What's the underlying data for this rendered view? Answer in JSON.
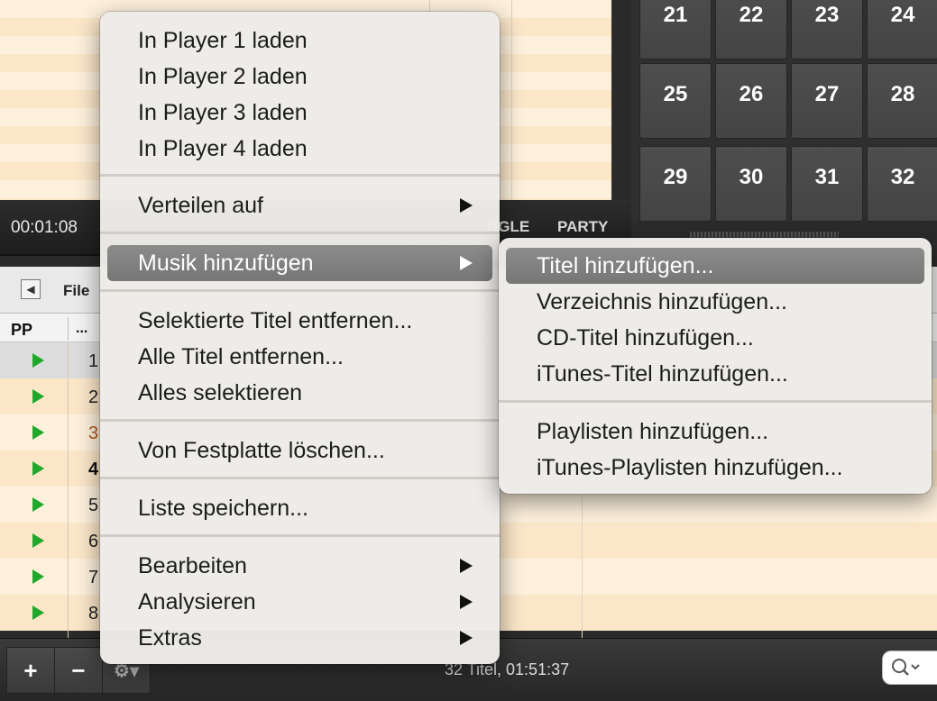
{
  "player": {
    "time": "00:01:08",
    "mode_single": "NGLE",
    "mode_party": "PARTY"
  },
  "pads": [
    "21",
    "22",
    "23",
    "24",
    "25",
    "26",
    "27",
    "28",
    "29",
    "30",
    "31",
    "32"
  ],
  "list": {
    "title": "File",
    "columns": {
      "pp": "PP",
      "num": "..."
    },
    "rows": [
      {
        "num": "1",
        "style": "selected"
      },
      {
        "num": "2",
        "style": "normal"
      },
      {
        "num": "3",
        "style": "orange"
      },
      {
        "num": "4",
        "style": "bold"
      },
      {
        "num": "5",
        "style": "normal"
      },
      {
        "num": "6",
        "style": "normal"
      },
      {
        "num": "7",
        "style": "normal"
      },
      {
        "num": "8",
        "style": "normal"
      }
    ],
    "status": "32 Titel,  01:51:37"
  },
  "bottom_bar": {
    "add_label": "+",
    "remove_label": "−",
    "gear_icon": "gear-icon",
    "search_icon": "search-icon"
  },
  "context_menu": {
    "items": [
      {
        "label": "In Player 1 laden"
      },
      {
        "label": "In Player 2 laden"
      },
      {
        "label": "In Player 3 laden"
      },
      {
        "label": "In Player 4 laden"
      },
      {
        "label": "Verteilen auf",
        "submenu": true
      },
      {
        "label": "Musik hinzufügen",
        "submenu": true,
        "highlighted": true
      },
      {
        "label": "Selektierte Titel entfernen..."
      },
      {
        "label": "Alle Titel entfernen..."
      },
      {
        "label": "Alles selektieren"
      },
      {
        "label": "Von Festplatte löschen..."
      },
      {
        "label": "Liste speichern..."
      },
      {
        "label": "Bearbeiten",
        "submenu": true
      },
      {
        "label": "Analysieren",
        "submenu": true
      },
      {
        "label": "Extras",
        "submenu": true
      }
    ]
  },
  "submenu": {
    "items": [
      {
        "label": "Titel hinzufügen...",
        "highlighted": true
      },
      {
        "label": "Verzeichnis hinzufügen..."
      },
      {
        "label": "CD-Titel hinzufügen..."
      },
      {
        "label": "iTunes-Titel hinzufügen..."
      },
      {
        "label": "Playlisten hinzufügen..."
      },
      {
        "label": "iTunes-Playlisten hinzufügen..."
      }
    ]
  }
}
